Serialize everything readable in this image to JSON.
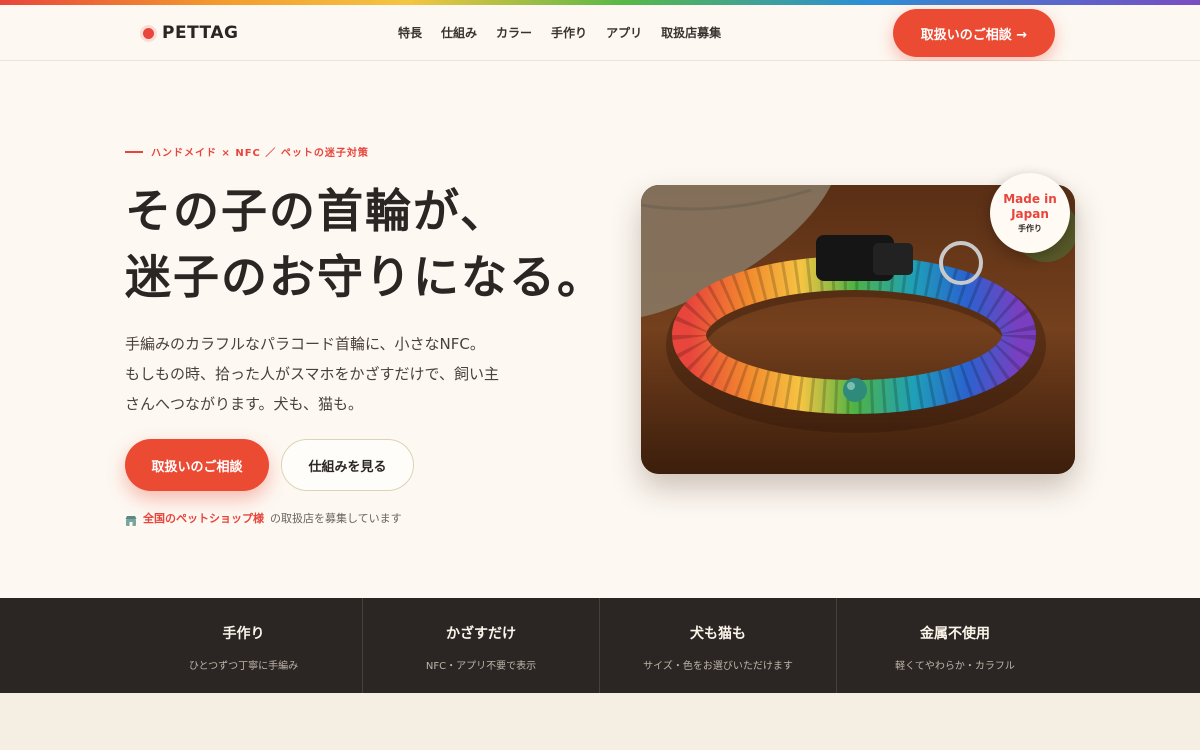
{
  "header": {
    "logo": "PETTAG",
    "nav": [
      "特長",
      "仕組み",
      "カラー",
      "手作り",
      "アプリ",
      "取扱店募集"
    ],
    "cta": "取扱いのご相談 →"
  },
  "hero": {
    "eyebrow": "ハンドメイド × NFC ／ ペットの迷子対策",
    "headline_line1": "その子の首輪が、",
    "headline_highlight": "迷子のお守り",
    "headline_line2_rest": "になる。",
    "lead": [
      "手編みのカラフルなパラコード首輪に、小さなNFC。",
      "もしもの時、拾った人がスマホをかざすだけで、飼い主",
      "さんへつながります。犬も、猫も。"
    ],
    "primary_button": "取扱いのご相談",
    "secondary_button": "仕組みを見る",
    "note_strong": "全国のペットショップ様",
    "note_rest": "の取扱店を募集しています"
  },
  "badge": {
    "main": "Made in Japan",
    "sub": "手作り"
  },
  "features": [
    {
      "title": "手作り",
      "desc": "ひとつずつ丁寧に手編み"
    },
    {
      "title": "かざすだけ",
      "desc": "NFC・アプリ不要で表示"
    },
    {
      "title": "犬も猫も",
      "desc": "サイズ・色をお選びいただけます"
    },
    {
      "title": "金属不使用",
      "desc": "軽くてやわらか・カラフル"
    }
  ],
  "colors": {
    "accent": "#eb4a33",
    "dark_band": "#2b2623",
    "background": "#fdf8f2"
  }
}
